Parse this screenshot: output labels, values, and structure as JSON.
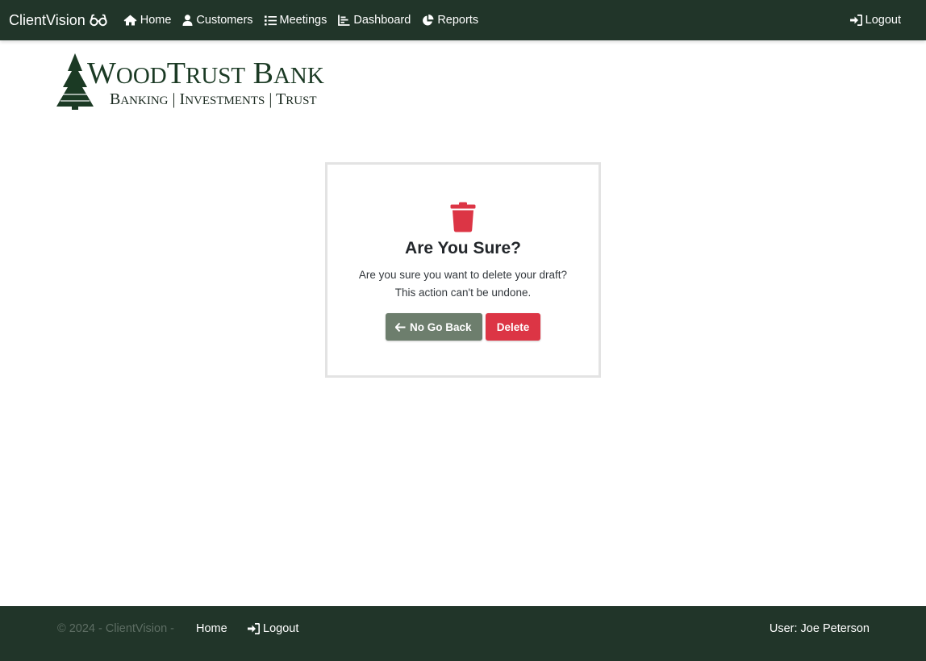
{
  "navbar": {
    "brand": "ClientVision",
    "brand_icon": "glasses-icon",
    "links": [
      {
        "label": "Home",
        "icon": "home-icon"
      },
      {
        "label": "Customers",
        "icon": "user-icon"
      },
      {
        "label": "Meetings",
        "icon": "list-icon"
      },
      {
        "label": "Dashboard",
        "icon": "chart-icon"
      },
      {
        "label": "Reports",
        "icon": "pie-chart-icon"
      }
    ],
    "logout": {
      "label": "Logout",
      "icon": "sign-in-icon"
    }
  },
  "logo": {
    "line1_parts": [
      "W",
      "OOD",
      "T",
      "RUST",
      " B",
      "ANK"
    ],
    "line2_parts": [
      "B",
      "ANKING",
      " | ",
      "I",
      "NVESTMENTS",
      " | ",
      "T",
      "RUST"
    ],
    "alt": "WoodTrust Bank - Banking | Investments | Trust"
  },
  "dialog": {
    "icon": "trash-icon",
    "title": "Are You Sure?",
    "message": "Are you sure you want to delete your draft? This action can't be undone.",
    "back_button": "No Go Back",
    "delete_button": "Delete"
  },
  "footer": {
    "copyright": "© 2024 - ClientVision -",
    "home": "Home",
    "logout": "Logout",
    "user": "User: Joe Peterson"
  },
  "colors": {
    "navbar": "#213529",
    "brand_green": "#1b3a24",
    "back_button": "#6d7e6d",
    "delete_button": "#dc3545",
    "trash_icon": "#dc3545"
  }
}
